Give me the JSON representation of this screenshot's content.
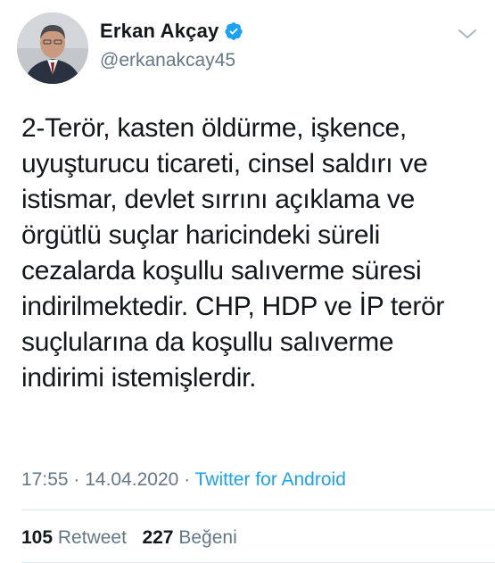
{
  "author": {
    "display_name": "Erkan Akçay",
    "handle": "@erkanakcay45",
    "verified": true,
    "avatar_icon": "profile-photo"
  },
  "tweet": {
    "text": "2-Terör, kasten öldürme, işkence,\nuyuşturucu ticareti, cinsel saldırı ve\nistismar, devlet sırrını açıklama ve\nörgütlü suçlar haricindeki süreli\ncezalarda koşullu salıverme süresi\nindirilmektedir. CHP, HDP ve İP terör\nsuçlularına da koşullu salıverme\nindirimi istemişlerdir."
  },
  "meta": {
    "time": "17:55",
    "separator": " · ",
    "date": "14.04.2020",
    "source": "Twitter for Android"
  },
  "stats": {
    "retweets": "105",
    "retweets_label": "Retweet",
    "likes": "227",
    "likes_label": "Beğeni"
  },
  "colors": {
    "accent": "#1da1f2",
    "secondary_text": "#657786",
    "primary_text": "#14171a"
  }
}
